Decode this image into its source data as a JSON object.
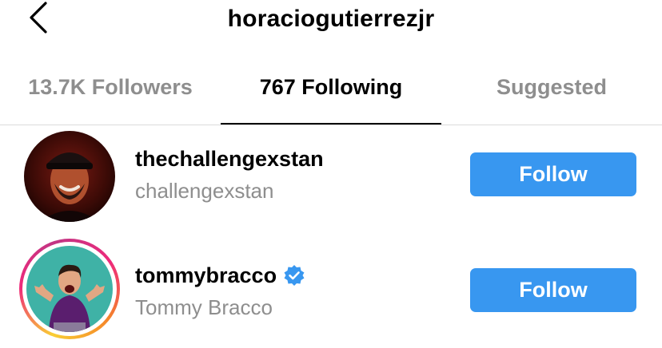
{
  "header": {
    "title": "horaciogutierrezjr",
    "back_icon": "chevron-left-icon"
  },
  "tabs": [
    {
      "label": "13.7K Followers",
      "active": false
    },
    {
      "label": "767 Following",
      "active": true
    },
    {
      "label": "Suggested",
      "active": false
    }
  ],
  "users": [
    {
      "username": "thechallengexstan",
      "full_name": "challengexstan",
      "verified": false,
      "has_story": false,
      "follow_label": "Follow"
    },
    {
      "username": "tommybracco",
      "full_name": "Tommy Bracco",
      "verified": true,
      "has_story": true,
      "follow_label": "Follow"
    }
  ],
  "colors": {
    "follow_button": "#3897f0",
    "verified_badge": "#3897f0",
    "inactive_tab": "#8e8e8e"
  }
}
